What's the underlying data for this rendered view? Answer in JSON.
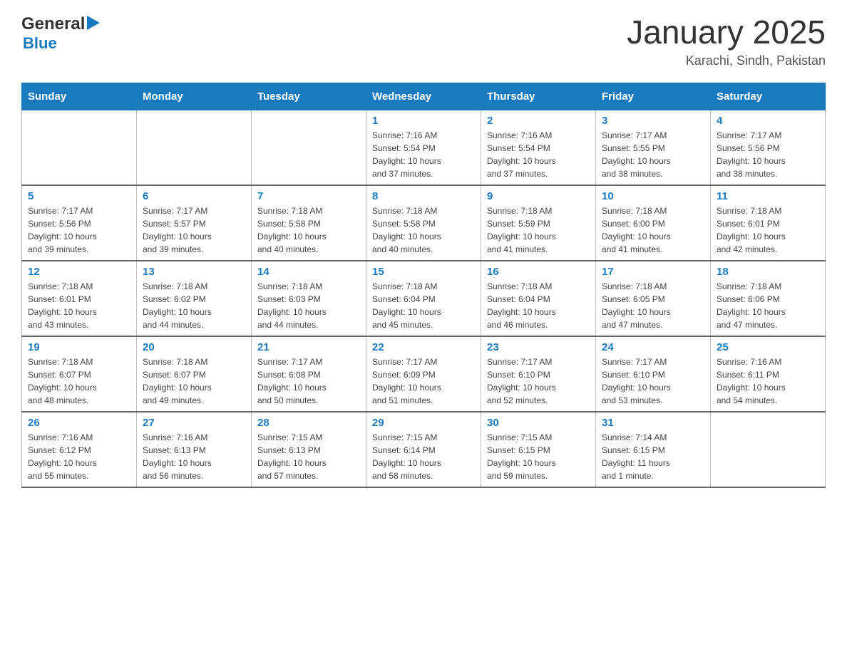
{
  "header": {
    "logo_general": "General",
    "logo_blue": "Blue",
    "main_title": "January 2025",
    "subtitle": "Karachi, Sindh, Pakistan"
  },
  "calendar": {
    "days_of_week": [
      "Sunday",
      "Monday",
      "Tuesday",
      "Wednesday",
      "Thursday",
      "Friday",
      "Saturday"
    ],
    "weeks": [
      [
        {
          "day": "",
          "info": ""
        },
        {
          "day": "",
          "info": ""
        },
        {
          "day": "",
          "info": ""
        },
        {
          "day": "1",
          "info": "Sunrise: 7:16 AM\nSunset: 5:54 PM\nDaylight: 10 hours\nand 37 minutes."
        },
        {
          "day": "2",
          "info": "Sunrise: 7:16 AM\nSunset: 5:54 PM\nDaylight: 10 hours\nand 37 minutes."
        },
        {
          "day": "3",
          "info": "Sunrise: 7:17 AM\nSunset: 5:55 PM\nDaylight: 10 hours\nand 38 minutes."
        },
        {
          "day": "4",
          "info": "Sunrise: 7:17 AM\nSunset: 5:56 PM\nDaylight: 10 hours\nand 38 minutes."
        }
      ],
      [
        {
          "day": "5",
          "info": "Sunrise: 7:17 AM\nSunset: 5:56 PM\nDaylight: 10 hours\nand 39 minutes."
        },
        {
          "day": "6",
          "info": "Sunrise: 7:17 AM\nSunset: 5:57 PM\nDaylight: 10 hours\nand 39 minutes."
        },
        {
          "day": "7",
          "info": "Sunrise: 7:18 AM\nSunset: 5:58 PM\nDaylight: 10 hours\nand 40 minutes."
        },
        {
          "day": "8",
          "info": "Sunrise: 7:18 AM\nSunset: 5:58 PM\nDaylight: 10 hours\nand 40 minutes."
        },
        {
          "day": "9",
          "info": "Sunrise: 7:18 AM\nSunset: 5:59 PM\nDaylight: 10 hours\nand 41 minutes."
        },
        {
          "day": "10",
          "info": "Sunrise: 7:18 AM\nSunset: 6:00 PM\nDaylight: 10 hours\nand 41 minutes."
        },
        {
          "day": "11",
          "info": "Sunrise: 7:18 AM\nSunset: 6:01 PM\nDaylight: 10 hours\nand 42 minutes."
        }
      ],
      [
        {
          "day": "12",
          "info": "Sunrise: 7:18 AM\nSunset: 6:01 PM\nDaylight: 10 hours\nand 43 minutes."
        },
        {
          "day": "13",
          "info": "Sunrise: 7:18 AM\nSunset: 6:02 PM\nDaylight: 10 hours\nand 44 minutes."
        },
        {
          "day": "14",
          "info": "Sunrise: 7:18 AM\nSunset: 6:03 PM\nDaylight: 10 hours\nand 44 minutes."
        },
        {
          "day": "15",
          "info": "Sunrise: 7:18 AM\nSunset: 6:04 PM\nDaylight: 10 hours\nand 45 minutes."
        },
        {
          "day": "16",
          "info": "Sunrise: 7:18 AM\nSunset: 6:04 PM\nDaylight: 10 hours\nand 46 minutes."
        },
        {
          "day": "17",
          "info": "Sunrise: 7:18 AM\nSunset: 6:05 PM\nDaylight: 10 hours\nand 47 minutes."
        },
        {
          "day": "18",
          "info": "Sunrise: 7:18 AM\nSunset: 6:06 PM\nDaylight: 10 hours\nand 47 minutes."
        }
      ],
      [
        {
          "day": "19",
          "info": "Sunrise: 7:18 AM\nSunset: 6:07 PM\nDaylight: 10 hours\nand 48 minutes."
        },
        {
          "day": "20",
          "info": "Sunrise: 7:18 AM\nSunset: 6:07 PM\nDaylight: 10 hours\nand 49 minutes."
        },
        {
          "day": "21",
          "info": "Sunrise: 7:17 AM\nSunset: 6:08 PM\nDaylight: 10 hours\nand 50 minutes."
        },
        {
          "day": "22",
          "info": "Sunrise: 7:17 AM\nSunset: 6:09 PM\nDaylight: 10 hours\nand 51 minutes."
        },
        {
          "day": "23",
          "info": "Sunrise: 7:17 AM\nSunset: 6:10 PM\nDaylight: 10 hours\nand 52 minutes."
        },
        {
          "day": "24",
          "info": "Sunrise: 7:17 AM\nSunset: 6:10 PM\nDaylight: 10 hours\nand 53 minutes."
        },
        {
          "day": "25",
          "info": "Sunrise: 7:16 AM\nSunset: 6:11 PM\nDaylight: 10 hours\nand 54 minutes."
        }
      ],
      [
        {
          "day": "26",
          "info": "Sunrise: 7:16 AM\nSunset: 6:12 PM\nDaylight: 10 hours\nand 55 minutes."
        },
        {
          "day": "27",
          "info": "Sunrise: 7:16 AM\nSunset: 6:13 PM\nDaylight: 10 hours\nand 56 minutes."
        },
        {
          "day": "28",
          "info": "Sunrise: 7:15 AM\nSunset: 6:13 PM\nDaylight: 10 hours\nand 57 minutes."
        },
        {
          "day": "29",
          "info": "Sunrise: 7:15 AM\nSunset: 6:14 PM\nDaylight: 10 hours\nand 58 minutes."
        },
        {
          "day": "30",
          "info": "Sunrise: 7:15 AM\nSunset: 6:15 PM\nDaylight: 10 hours\nand 59 minutes."
        },
        {
          "day": "31",
          "info": "Sunrise: 7:14 AM\nSunset: 6:15 PM\nDaylight: 11 hours\nand 1 minute."
        },
        {
          "day": "",
          "info": ""
        }
      ]
    ]
  }
}
